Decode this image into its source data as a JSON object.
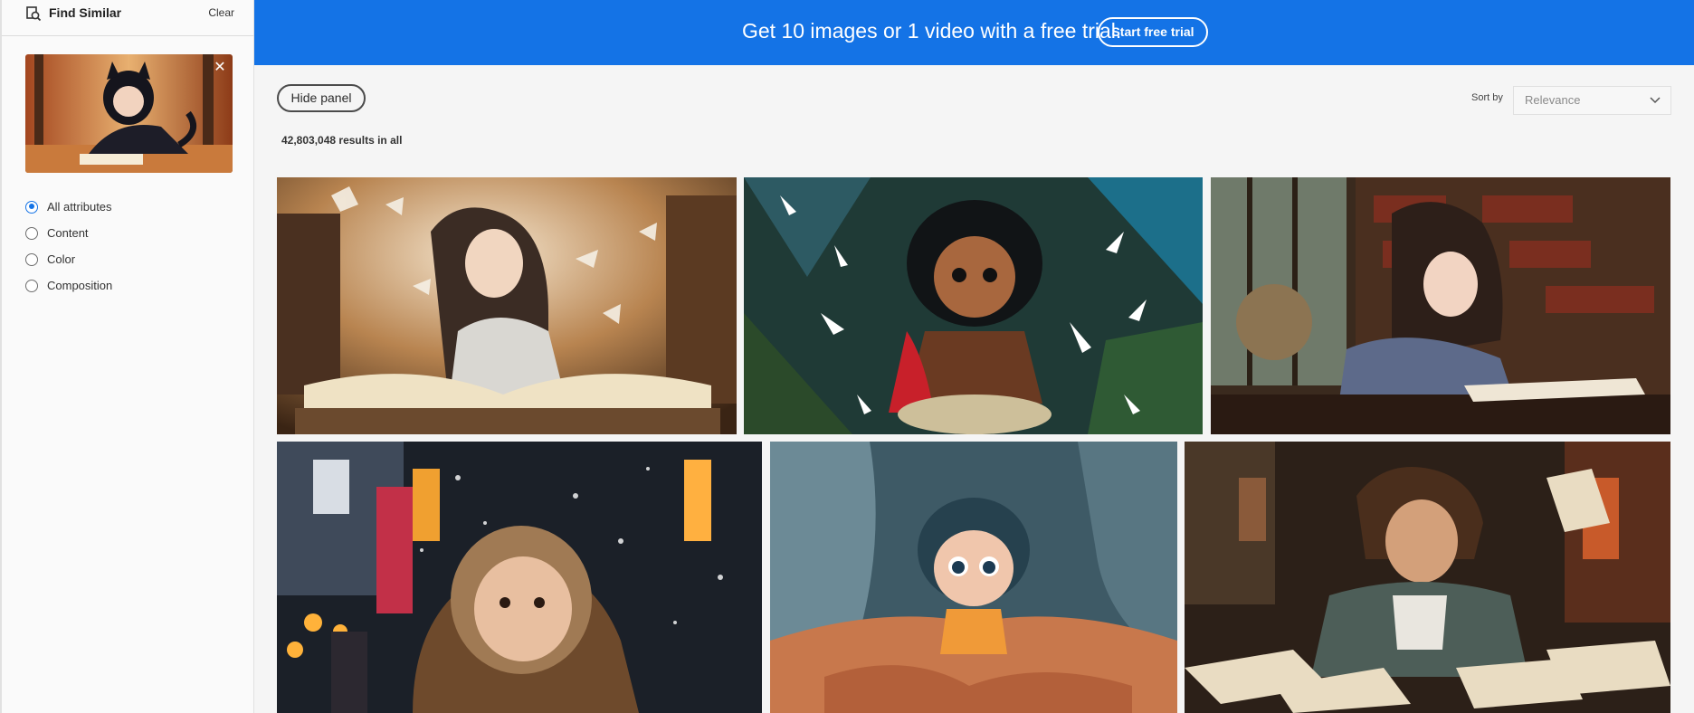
{
  "sidebar": {
    "title": "Find Similar",
    "clear_label": "Clear",
    "close_symbol": "✕",
    "attributes": [
      {
        "label": "All attributes",
        "checked": true
      },
      {
        "label": "Content",
        "checked": false
      },
      {
        "label": "Color",
        "checked": false
      },
      {
        "label": "Composition",
        "checked": false
      }
    ]
  },
  "banner": {
    "text": "Get 10 images or 1 video with a free trial.",
    "cta_label": "Start free trial",
    "color": "#1473e6"
  },
  "toolbar": {
    "hide_panel_label": "Hide panel",
    "sort_label": "Sort by",
    "sort_value": "Relevance",
    "results_text": "42,803,048 results in all"
  },
  "images": [
    {
      "name": "girl-reading-library"
    },
    {
      "name": "boy-with-butterflies"
    },
    {
      "name": "girl-writing-library"
    },
    {
      "name": "child-in-snow-city"
    },
    {
      "name": "child-under-blanket"
    },
    {
      "name": "boy-with-papers"
    }
  ]
}
